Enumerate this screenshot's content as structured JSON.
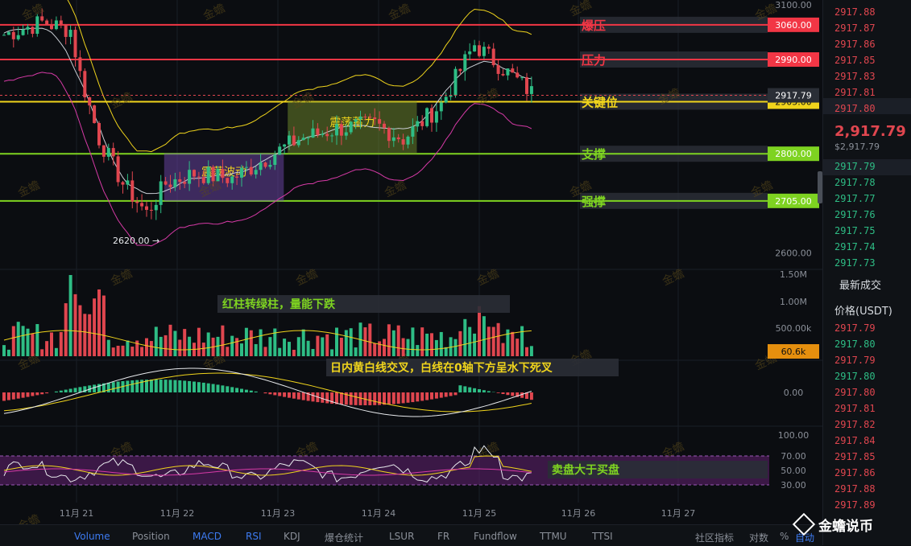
{
  "chart_data": {
    "type": "candlestick",
    "price_axis": {
      "ticks": [
        3100,
        2600
      ],
      "tick_labels": [
        "3100.00",
        "2600.00"
      ],
      "range": [
        2575,
        3110
      ]
    },
    "x_ticks": [
      "11月 21",
      "11月 22",
      "11月 23",
      "11月 24",
      "11月 25",
      "11月 26",
      "11月 27"
    ],
    "levels": [
      {
        "label": "爆压",
        "price": 3060,
        "tag": "3060.00",
        "color": "#f23645"
      },
      {
        "label": "压力",
        "price": 2990,
        "tag": "2990.00",
        "color": "#f23645"
      },
      {
        "label": "关键位",
        "price": 2905,
        "tag": "2905.00",
        "color": "#f0d41c"
      },
      {
        "label": "支撑",
        "price": 2800,
        "tag": "2800.00",
        "color": "#7ed321"
      },
      {
        "label": "强撑",
        "price": 2705,
        "tag": "2705.00",
        "color": "#7ed321"
      }
    ],
    "current_price_tag": "2917.79",
    "boxes": [
      {
        "label": "震荡波动",
        "start_index": 27,
        "end_index": 52,
        "price_low": 2705,
        "price_high": 2800,
        "color": "#7b4dbb"
      },
      {
        "label": "震荡蓄力",
        "start_index": 53,
        "end_index": 80,
        "price_low": 2800,
        "price_high": 2905,
        "color": "#7c9a2e"
      }
    ],
    "low_marker": "2620.00 →",
    "volume_panel": {
      "ticks": [
        "1.50M",
        "1.00M",
        "500.00k"
      ],
      "current_tag": "60.6k",
      "annotation": "红柱转绿柱，量能下跌"
    },
    "macd_panel": {
      "tick": "0.00",
      "annotation": "日内黄白线交叉，白线在0轴下方呈水下死叉"
    },
    "rsi_panel": {
      "ticks": [
        "100.00",
        "70.00",
        "50.00",
        "30.00"
      ],
      "annotation": "卖盘大于买盘"
    },
    "watermark": "金蟾"
  },
  "orderbook": {
    "asks": [
      "2917.88",
      "2917.87",
      "2917.86",
      "2917.85",
      "2917.83",
      "2917.81",
      "2917.80"
    ],
    "last_price": "2,917.79",
    "mark_price": "$2,917.79",
    "bids": [
      "2917.79",
      "2917.78",
      "2917.77",
      "2917.76",
      "2917.75",
      "2917.74",
      "2917.73"
    ],
    "trades_title": "最新成交",
    "trades_header": "价格(USDT)",
    "trades": [
      "2917.79",
      "2917.80",
      "2917.79",
      "2917.80",
      "2917.80",
      "2917.81",
      "2917.82",
      "2917.84",
      "2917.85",
      "2917.86",
      "2917.88",
      "2917.89"
    ],
    "trade_sides": [
      "ask",
      "bid",
      "ask",
      "bid",
      "ask",
      "ask",
      "ask",
      "ask",
      "ask",
      "ask",
      "ask",
      "ask"
    ]
  },
  "bottom_tabs": [
    "Volume",
    "Position",
    "MACD",
    "RSI",
    "KDJ",
    "爆仓统计",
    "LSUR",
    "FR",
    "Fundflow",
    "TTMU",
    "TTSI",
    "社区指标",
    "对数",
    "%",
    "自动"
  ],
  "active_tabs": [
    "Volume",
    "MACD",
    "RSI",
    "自动"
  ],
  "brand": "金蟾说币"
}
